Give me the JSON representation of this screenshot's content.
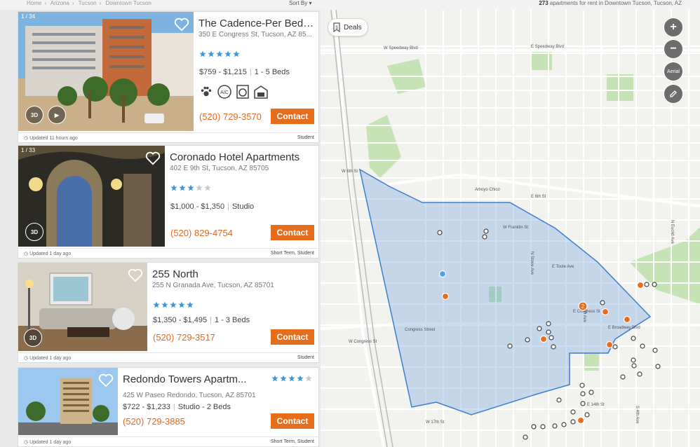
{
  "breadcrumb": [
    "Home",
    "Arizona",
    "Tucson",
    "Downtown Tucson"
  ],
  "sort_label": "Sort By",
  "results_count": "273",
  "results_text": "apartments for rent in Downtown Tucson, Tucson, AZ",
  "listings": [
    {
      "photo_count": "1 / 34",
      "name": "The Cadence-Per Bed L...",
      "address": "350 E Congress St, Tucson, AZ 85...",
      "rating": 5,
      "price": "$759 - $1,215",
      "beds": "1 - 5 Beds",
      "amenities": [
        "paw-icon",
        "ac-icon",
        "laundry-icon",
        "garage-icon"
      ],
      "phone": "(520) 729-3570",
      "contact_label": "Contact",
      "updated": "Updated 11 hours ago",
      "tag": "Student"
    },
    {
      "photo_count": "1 / 33",
      "name": "Coronado Hotel Apartments",
      "address": "402 E 9th St, Tucson, AZ 85705",
      "rating": 3,
      "price": "$1,000 - $1,350",
      "beds": "Studio",
      "phone": "(520) 829-4754",
      "contact_label": "Contact",
      "updated": "Updated 1 day ago",
      "tag": "Short Term, Student"
    },
    {
      "name": "255 North",
      "address": "255 N Granada Ave, Tucson, AZ 85701",
      "rating": 5,
      "price": "$1,350 - $1,495",
      "beds": "1 - 3 Beds",
      "phone": "(520) 729-3517",
      "contact_label": "Contact",
      "updated": "Updated 1 day ago",
      "tag": "Student"
    },
    {
      "name": "Redondo Towers Apartm...",
      "address": "425 W Paseo Redondo, Tucson, AZ 85701",
      "rating": 4,
      "price": "$722 - $1,233",
      "beds": "Studio - 2 Beds",
      "phone": "(520) 729-3885",
      "contact_label": "Contact",
      "updated": "Updated 1 day ago",
      "tag": "Short Term, Student"
    }
  ],
  "map": {
    "deals_label": "Deals",
    "aerial_label": "Aerial",
    "streets": [
      "W Speedway Blvd",
      "E Speedway Blvd",
      "W 6th St",
      "E 6th St",
      "Amoyo Chico",
      "Congress Street",
      "E Congress St",
      "E Broadway Blvd",
      "E Toole Ave",
      "E 14th St",
      "W Franklin St",
      "W 17th St",
      "E Speedway Blvd",
      "W Congress St",
      "N Stone Ave",
      "N 4th Ave",
      "S 4th Ave",
      "S 6th Ave",
      "N 6th Ave",
      "N Euclid Ave"
    ],
    "cluster_label": "2"
  },
  "colors": {
    "accent": "#e56d1c",
    "star": "#3b9ad9",
    "boundary": "#3d7ed1"
  }
}
